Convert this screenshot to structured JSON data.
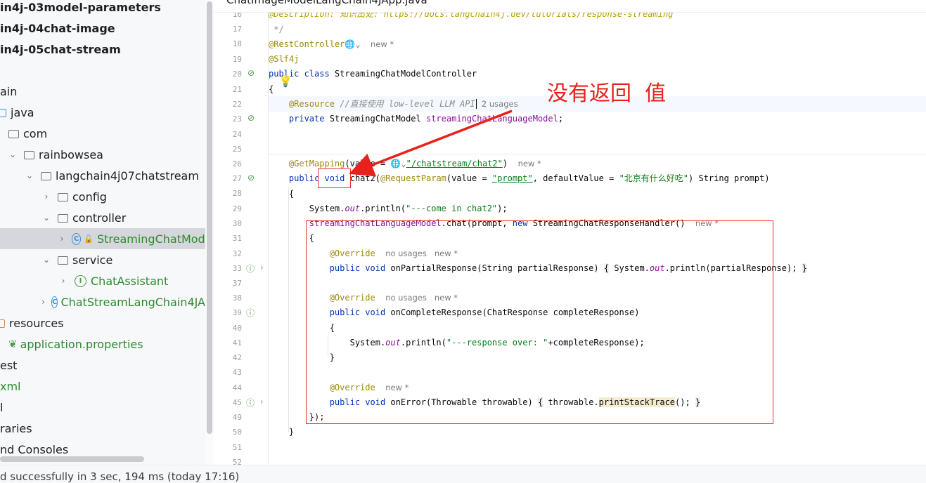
{
  "tree": {
    "items": [
      {
        "label": "in4j-03model-parameters"
      },
      {
        "label": "in4j-04chat-image"
      },
      {
        "label": "in4j-05chat-stream"
      },
      {
        "label": "ain"
      },
      {
        "label": "java"
      },
      {
        "label": "com"
      },
      {
        "label": "rainbowsea"
      },
      {
        "label": "langchain4j07chatstream"
      },
      {
        "label": "config"
      },
      {
        "label": "controller"
      },
      {
        "label": "StreamingChatModel"
      },
      {
        "label": "service"
      },
      {
        "label": "ChatAssistant"
      },
      {
        "label": "ChatStreamLangChain4JA"
      },
      {
        "label": "resources"
      },
      {
        "label": "application.properties"
      },
      {
        "label": "est"
      },
      {
        "label": "xml"
      },
      {
        "label": "l"
      },
      {
        "label": "raries"
      },
      {
        "label": "nd Consoles"
      }
    ]
  },
  "editor": {
    "tab_title": "ChatImageModelLangChain4JApp.java",
    "line_numbers": [
      "16",
      "17",
      "18",
      "19",
      "20",
      "21",
      "22",
      "23",
      "24",
      "25",
      "26",
      "27",
      "28",
      "29",
      "30",
      "31",
      "32",
      "33",
      "37",
      "38",
      "39",
      "40",
      "41",
      "42",
      "43",
      "44",
      "45",
      "49",
      "50",
      "51",
      "52"
    ],
    "code": {
      "l16_tag": "@Description:",
      "l16_text": " 知识出处: https://docs.langchain4j.dev/tutorials/response-streaming",
      "l17": " */",
      "l18_ann": "@RestController",
      "l18_hint": "new *",
      "l19_ann": "@Slf4j",
      "l20_kw": "public class",
      "l20_name": " StreamingChatModelController",
      "l21": "{",
      "l22_ann": "@Resource",
      "l22_cmt": " //直接使用 low-level LLM API",
      "l22_hint": "2 usages",
      "l23_kw": "private",
      "l23_type": " StreamingChatModel ",
      "l23_field": "streamingChatLanguageModel",
      "l23_end": ";",
      "l26_ann": "@GetMapping",
      "l26_val": "(value = ",
      "l26_str": "\"/chatstream/chat2\"",
      "l26_end": ")",
      "l26_hint": "new *",
      "l27_kw": "public",
      "l27_void": "void",
      "l27_name": " chat2(",
      "l27_ann": "@RequestParam",
      "l27_a": "(value = ",
      "l27_s1": "\"prompt\"",
      "l27_b": ", defaultValue = ",
      "l27_s2": "\"北京有什么好吃\"",
      "l27_c": ") String prompt)",
      "l28": "{",
      "l29_a": "System.",
      "l29_out": "out",
      "l29_b": ".println(",
      "l29_s": "\"---come in chat2\"",
      "l29_c": ");",
      "l30_field": "streamingChatLanguageModel",
      "l30_a": ".chat(prompt, ",
      "l30_kw": "new",
      "l30_b": " StreamingChatResponseHandler()",
      "l30_hint": "new *",
      "l31": "{",
      "l32_ann": "@Override",
      "l32_hint": "no usages   new *",
      "l33_kw": "public void",
      "l33_a": " onPartialResponse(String partialResponse) ",
      "l33_b": "{",
      "l33_c": " System.",
      "l33_out": "out",
      "l33_d": ".println(partialResponse); ",
      "l33_e": "}",
      "l38_ann": "@Override",
      "l38_hint": "no usages   new *",
      "l39_kw": "public void",
      "l39_a": " onCompleteResponse(ChatResponse completeResponse)",
      "l40": "{",
      "l41_a": "System.",
      "l41_out": "out",
      "l41_b": ".println(",
      "l41_s": "\"---response over: \"",
      "l41_c": "+completeResponse);",
      "l42": "}",
      "l44_ann": "@Override",
      "l44_hint": "new *",
      "l45_kw": "public void",
      "l45_a": " onError(Throwable throwable) ",
      "l45_b": "{",
      "l45_c": " throwable.",
      "l45_m": "printStackTrace",
      "l45_d": "(); ",
      "l45_e": "}",
      "l49": "});",
      "l50": "}"
    }
  },
  "annotation": {
    "note": "没有返回  值",
    "color": "#e8211c"
  },
  "status": {
    "text": "d successfully in 3 sec, 194 ms (today 17:16)"
  }
}
